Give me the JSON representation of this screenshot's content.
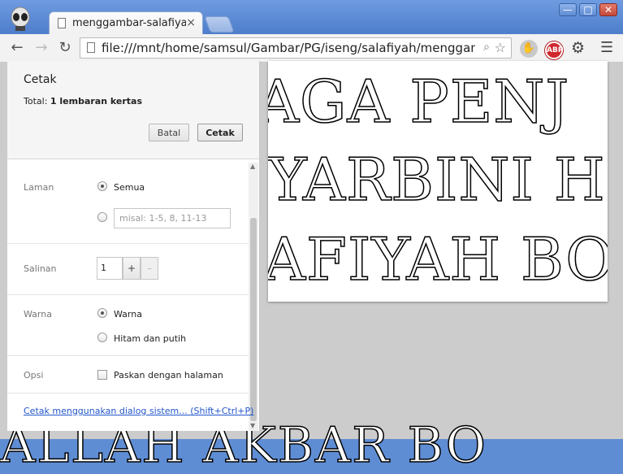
{
  "browser": {
    "tab_title": "menggambar-salafiyah",
    "tab_close": "×",
    "url": "file:///mnt/home/samsul/Gambar/PG/iseng/salafiyah/menggaml",
    "nav": {
      "back": "←",
      "forward": "→",
      "reload": "↻"
    },
    "window": {
      "minimize": "—",
      "maximize": "□",
      "close": "✕"
    },
    "extensions": {
      "abp": "ABP",
      "hand": "✋"
    },
    "icons": {
      "zoom": "search-icon",
      "star": "star-icon",
      "gear": "gear-icon",
      "menu": "menu-icon"
    }
  },
  "print": {
    "title": "Cetak",
    "total_label": "Total:",
    "total_value": "1 lembaran kertas",
    "cancel_label": "Batal",
    "print_label": "Cetak",
    "pages": {
      "label": "Laman",
      "all_label": "Semua",
      "range_placeholder": "misal: 1-5, 8, 11-13",
      "selected": "all"
    },
    "copies": {
      "label": "Salinan",
      "value": "1",
      "plus": "+",
      "minus": "–"
    },
    "color": {
      "label": "Warna",
      "color_label": "Warna",
      "bw_label": "Hitam dan putih",
      "selected": "color"
    },
    "options": {
      "label": "Opsi",
      "fit_label": "Paskan dengan halaman",
      "fit_checked": false
    },
    "system_dialog_link": "Cetak menggunakan dialog sistem... (Shift+Ctrl+P)"
  },
  "preview": {
    "line1": "AGA PENJ",
    "line2": "YARBINI H",
    "line3": "AFIYAH BO"
  },
  "background_text": "ALLAH AKBAR BO"
}
